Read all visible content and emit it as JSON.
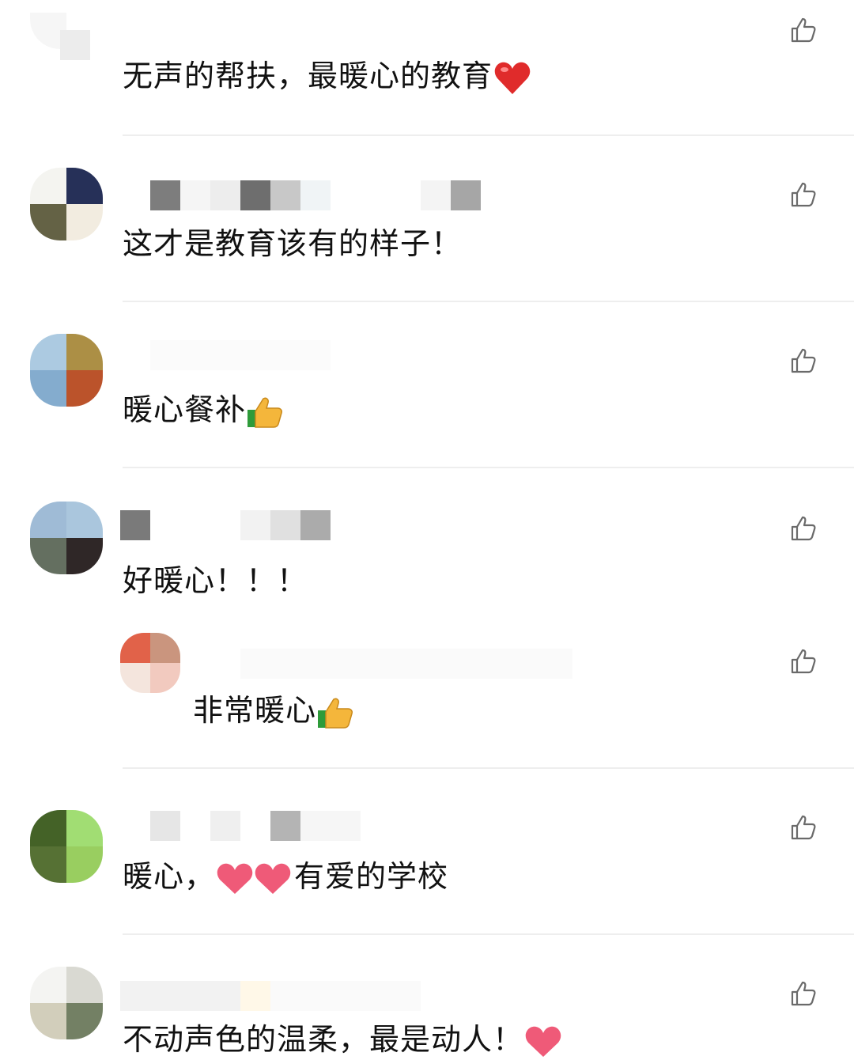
{
  "comments": [
    {
      "text": "无声的帮扶，最暖心的教育",
      "emoji": "heart-red"
    },
    {
      "text": "这才是教育该有的样子！"
    },
    {
      "text": "暖心餐补",
      "emoji": "thumbs-up"
    },
    {
      "text": "好暖心！！！",
      "reply": {
        "text": "非常暖心",
        "emoji": "thumbs-up"
      }
    },
    {
      "text_before": "暖心，",
      "text_after": "有爱的学校",
      "emoji": "double-heart"
    },
    {
      "text": "不动声色的温柔，最是动人！",
      "emoji": "heart-pink"
    }
  ],
  "colors": {
    "text": "#111111",
    "divider": "#eeeeee",
    "icon": "#6a6a6a"
  }
}
